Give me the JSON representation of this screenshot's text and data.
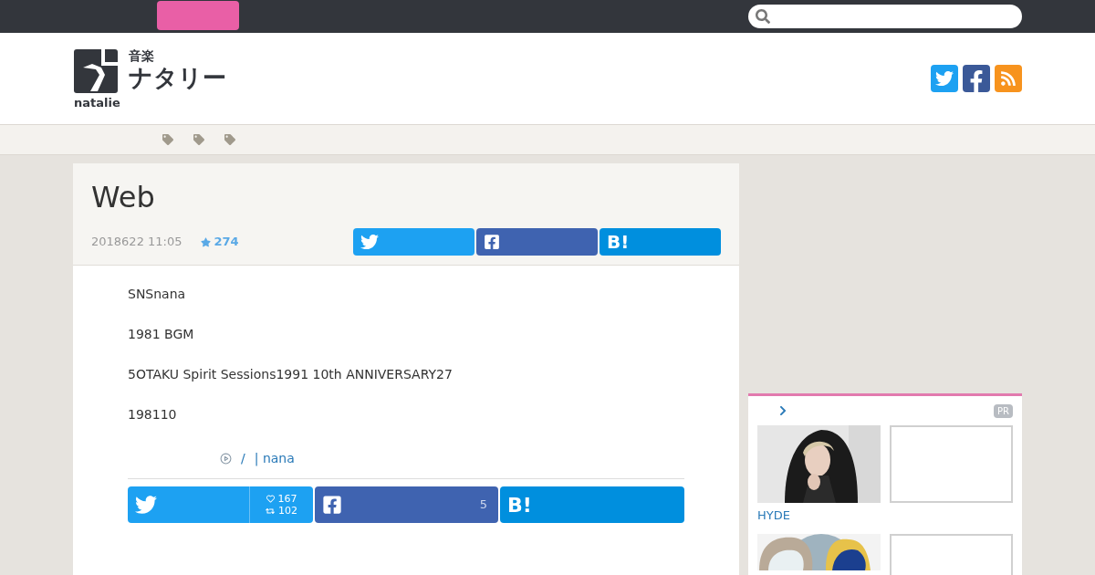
{
  "logo": {
    "category": "音楽",
    "name": "ナタリー",
    "brand": "natalie"
  },
  "tags": [
    {
      "kind": "tag"
    },
    {
      "kind": "tag"
    },
    {
      "kind": "tag"
    }
  ],
  "article": {
    "title": "Web",
    "date": "2018622 11:05",
    "favorites": "274",
    "share_top": [
      {
        "kind": "twitter"
      },
      {
        "kind": "facebook"
      },
      {
        "kind": "hatena",
        "label": "B!"
      }
    ],
    "paragraphs": [
      "SNSnana",
      "1981 BGM",
      "5OTAKU Spirit Sessions1991 10th ANNIVERSARY27",
      "198110"
    ],
    "source": {
      "separator": "/",
      "link": "| nana"
    },
    "share_bottom": [
      {
        "kind": "twitter",
        "likes": "167",
        "retweets": "102"
      },
      {
        "kind": "facebook",
        "count": "5"
      },
      {
        "kind": "hatena",
        "label": "B!"
      }
    ]
  },
  "sidebar": {
    "badge": "PR",
    "items": [
      {
        "kind": "person",
        "caption": "HYDE"
      },
      {
        "kind": "blank"
      },
      {
        "kind": "cartoon"
      },
      {
        "kind": "blank"
      }
    ]
  }
}
